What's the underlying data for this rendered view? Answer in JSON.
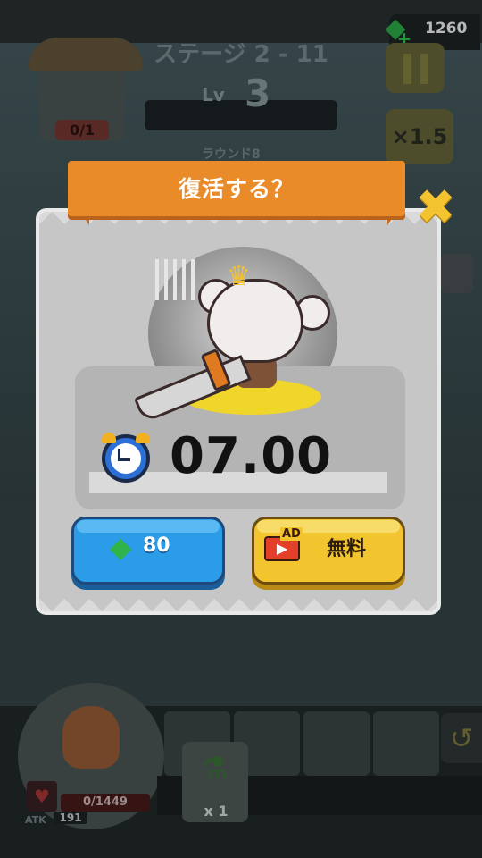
{
  "hud": {
    "gems": "1260",
    "stage_title": "ステージ 2 - 11",
    "level_label": "Lv",
    "level_value": "3",
    "round_label": "ラウンド8",
    "boss_count": "0/1",
    "speed_label": "×1.5"
  },
  "player": {
    "hp": "0/1449",
    "atk_label": "ATK",
    "atk_value": "191",
    "potion_count": "x 1"
  },
  "revive_dialog": {
    "title": "復活する？",
    "timer": "07.00",
    "gem_button_label": "80",
    "ad_badge": "AD",
    "free_button_label": "無料"
  },
  "icons": {
    "gem": "gem-icon",
    "close": "close-icon",
    "clock": "alarm-clock-icon",
    "ad": "video-ad-icon",
    "heart": "heart-icon",
    "potion": "potion-icon",
    "undo": "undo-arrow-icon",
    "pause": "pause-icon"
  },
  "colors": {
    "banner": "#ea8b2a",
    "gem_button": "#2b9ce8",
    "free_button": "#f2c42e",
    "close": "#f4c430"
  }
}
